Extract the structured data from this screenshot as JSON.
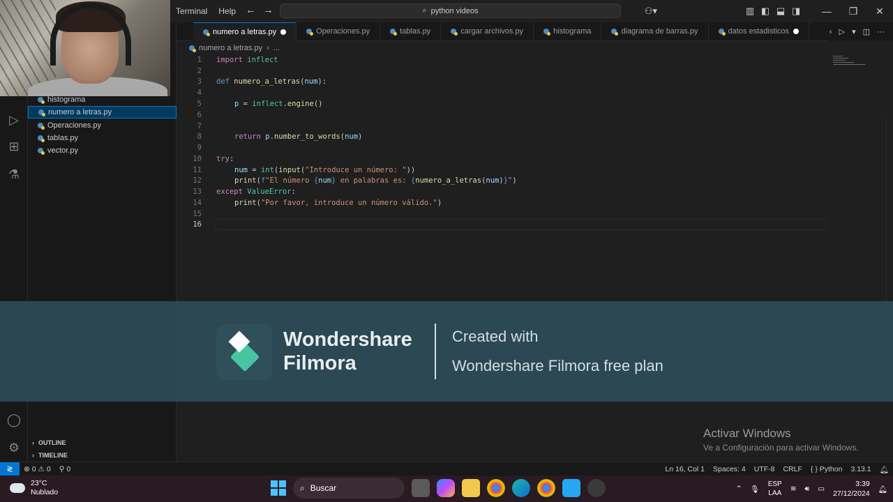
{
  "titlebar": {
    "menus": [
      "Terminal",
      "Help"
    ],
    "search_text": "python videos"
  },
  "sidebar": {
    "files": [
      {
        "label": "histograma",
        "active": false
      },
      {
        "label": "numero a letras.py",
        "active": true
      },
      {
        "label": "Operaciones.py",
        "active": false
      },
      {
        "label": "tablas.py",
        "active": false
      },
      {
        "label": "vector.py",
        "active": false
      }
    ],
    "outline_label": "OUTLINE",
    "timeline_label": "TIMELINE"
  },
  "tabs": [
    {
      "label": "numero a letras.py",
      "active": true,
      "modified": true
    },
    {
      "label": "Operaciones.py",
      "active": false
    },
    {
      "label": "tablas.py",
      "active": false
    },
    {
      "label": "cargar archivos.py",
      "active": false
    },
    {
      "label": "histograma",
      "active": false
    },
    {
      "label": "diagrama de barras.py",
      "active": false
    },
    {
      "label": "datos estadisticos",
      "active": false,
      "modified": true
    }
  ],
  "breadcrumb": {
    "file": "numero a letras.py",
    "more": "..."
  },
  "editor": {
    "line_numbers": [
      "1",
      "2",
      "3",
      "4",
      "5",
      "6",
      "7",
      "8",
      "9",
      "10",
      "11",
      "12",
      "13",
      "14",
      "15",
      "16"
    ],
    "current_line": "16",
    "lines": {
      "l1_kw": "import",
      "l1_mod": "inflect",
      "l3_kw": "def",
      "l3_fn": "numero_a_letras",
      "l3_p": "(",
      "l3_param": "num",
      "l3_end": "):",
      "l5_var": "p",
      "l5_eq": " = ",
      "l5_mod": "inflect",
      "l5_dot": ".",
      "l5_fn": "engine",
      "l5_end": "()",
      "l8_kw": "return",
      "l8_var": "p",
      "l8_dot": ".",
      "l8_fn": "number_to_words",
      "l8_p": "(",
      "l8_arg": "num",
      "l8_end": ")",
      "l10_kw": "try",
      "l10_end": ":",
      "l11_var": "num",
      "l11_eq": " = ",
      "l11_fn1": "int",
      "l11_p1": "(",
      "l11_fn2": "input",
      "l11_p2": "(",
      "l11_str": "\"Introduce un número: \"",
      "l11_end": "))",
      "l12_fn": "print",
      "l12_p": "(",
      "l12_f": "f",
      "l12_s1": "\"El número ",
      "l12_b1": "{",
      "l12_v1": "num",
      "l12_b2": "}",
      "l12_s2": " en palabras es: ",
      "l12_b3": "{",
      "l12_call": "numero_a_letras",
      "l12_cp": "(",
      "l12_arg": "num",
      "l12_cpe": ")",
      "l12_b4": "}",
      "l12_s3": "\"",
      "l12_end": ")",
      "l13_kw": "except",
      "l13_cls": "ValueError",
      "l13_end": ":",
      "l14_fn": "print",
      "l14_p": "(",
      "l14_str": "\"Por favor, introduce un número válido.\"",
      "l14_end": ")"
    }
  },
  "watermark": {
    "brand_line1": "Wondershare",
    "brand_line2": "Filmora",
    "created_with": "Created with",
    "plan": "Wondershare Filmora free plan"
  },
  "activate_windows": {
    "title": "Activar Windows",
    "subtitle": "Ve a Configuración para activar Windows."
  },
  "statusbar": {
    "errors": "0",
    "warnings": "0",
    "ports": "0",
    "position": "Ln 16, Col 1",
    "spaces": "Spaces: 4",
    "encoding": "UTF-8",
    "eol": "CRLF",
    "language_icon": "{ }",
    "language": "Python",
    "version": "3.13.1"
  },
  "taskbar": {
    "temperature": "23°C",
    "weather": "Nublado",
    "search_placeholder": "Buscar",
    "lang_top": "ESP",
    "lang_bottom": "LAA",
    "time": "3:39",
    "date": "27/12/2024"
  },
  "colors": {
    "accent": "#0078d4",
    "banner_bg": "#2c4b57",
    "filmora_green": "#47c5a3"
  }
}
